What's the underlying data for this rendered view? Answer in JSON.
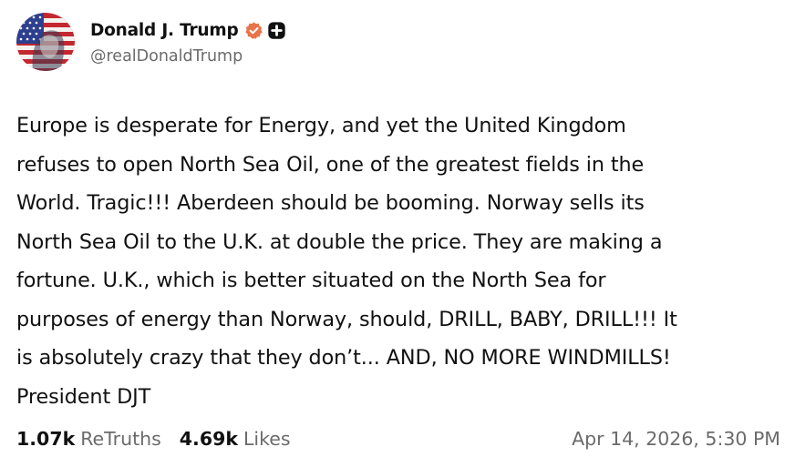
{
  "author": {
    "display_name": "Donald J. Trump",
    "handle": "@realDonaldTrump",
    "avatar_icon": "flag-portrait-avatar",
    "verified_icon": "verified-badge-icon",
    "verified_color": "#e8734a",
    "extra_badge_icon": "plus-badge-icon"
  },
  "post": {
    "text": "Europe is desperate for Energy, and yet the United Kingdom\nrefuses to open North Sea Oil, one of the greatest fields in the\nWorld. Tragic!!! Aberdeen should be booming. Norway sells its\nNorth Sea Oil to the U.K. at double the price. They are making a\nfortune. U.K., which is better situated on the North Sea for\npurposes of energy than Norway, should, DRILL, BABY, DRILL!!! It\nis absolutely crazy that they don’t... AND, NO MORE WINDMILLS!\nPresident DJT"
  },
  "stats": {
    "retruths_count": "1.07k",
    "retruths_label": "ReTruths",
    "likes_count": "4.69k",
    "likes_label": "Likes"
  },
  "timestamp": "Apr 14, 2026, 5:30 PM"
}
